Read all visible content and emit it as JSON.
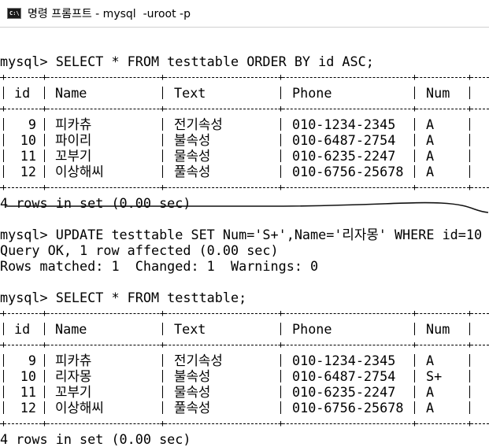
{
  "window": {
    "title": "명령 프롬프트 - mysql  -uroot -p",
    "icon": "cmd-icon"
  },
  "block1": {
    "command": "mysql> SELECT * FROM testtable ORDER BY id ASC;",
    "headers": [
      "id",
      "Name",
      "Text",
      "Phone",
      "Num"
    ],
    "rows": [
      [
        "9",
        "피카츄",
        "전기속성",
        "010-1234-2345",
        "A"
      ],
      [
        "10",
        "파이리",
        "불속성",
        "010-6487-2754",
        "A"
      ],
      [
        "11",
        "꼬부기",
        "물속성",
        "010-6235-2247",
        "A"
      ],
      [
        "12",
        "이상해씨",
        "풀속성",
        "010-6756-25678",
        "A"
      ]
    ],
    "result": "4 rows in set (0.00 sec)"
  },
  "block2": {
    "command": "mysql> UPDATE testtable SET Num='S+',Name='리자몽' WHERE id=10",
    "result1": "Query OK, 1 row affected (0.00 sec)",
    "result2": "Rows matched: 1  Changed: 1  Warnings: 0"
  },
  "block3": {
    "command": "mysql> SELECT * FROM testtable;",
    "headers": [
      "id",
      "Name",
      "Text",
      "Phone",
      "Num"
    ],
    "rows": [
      [
        "9",
        "피카츄",
        "전기속성",
        "010-1234-2345",
        "A"
      ],
      [
        "10",
        "리자몽",
        "불속성",
        "010-6487-2754",
        "S+"
      ],
      [
        "11",
        "꼬부기",
        "물속성",
        "010-6235-2247",
        "A"
      ],
      [
        "12",
        "이상해씨",
        "풀속성",
        "010-6756-25678",
        "A"
      ]
    ],
    "result": "4 rows in set (0.00 sec)"
  }
}
